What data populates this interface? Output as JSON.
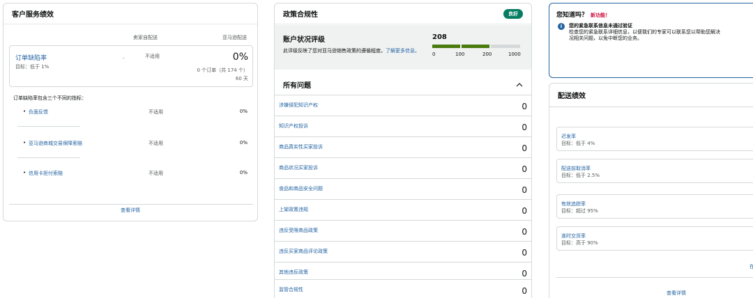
{
  "col1": {
    "title": "客户服务绩效",
    "col_self": "卖家自配送",
    "col_amazon": "亚马逊配送",
    "odr": {
      "name": "订单缺陷率",
      "goal": "目标：低于 1%",
      "dot": ".",
      "self_value": "不适用",
      "amazon_value": "0%",
      "orders": "0 个订单（共 174 个）",
      "days": "60 天"
    },
    "intro": "订单缺陷率包含三个不同的指标：",
    "items": [
      {
        "label": "负面反馈",
        "self": "不适用",
        "amazon": "0%"
      },
      {
        "label": "亚马逊商城交易保障索赔",
        "self": "不适用",
        "amazon": "0%"
      },
      {
        "label": "信用卡拒付索赔",
        "self": "不适用",
        "amazon": "0%"
      }
    ],
    "footer_link": "查看详情"
  },
  "col2": {
    "title": "政策合规性",
    "badge": "良好",
    "badge_color": "#067d62",
    "status_title": "账户状况评级",
    "status_desc_a": "此评级反映了您对亚马逊销售政策的遵循程度。",
    "status_desc_link": "了解更多信息。",
    "score": "208",
    "score_value": 208,
    "ticks": [
      "0",
      "100",
      "200",
      "1000"
    ],
    "issues_title": "所有问题",
    "issues": [
      {
        "label": "涉嫌侵犯知识产权",
        "count": "0"
      },
      {
        "label": "知识产权投诉",
        "count": "0"
      },
      {
        "label": "商品真实性买家投诉",
        "count": "0"
      },
      {
        "label": "商品状况买家投诉",
        "count": "0"
      },
      {
        "label": "食品和商品安全问题",
        "count": "0"
      },
      {
        "label": "上架政策违规",
        "count": "0"
      },
      {
        "label": "违反受限商品政策",
        "count": "0"
      },
      {
        "label": "违反买家商品评论政策",
        "count": "0"
      },
      {
        "label": "其他违反政策",
        "count": "0"
      },
      {
        "label": "监管合规性",
        "count": "0"
      }
    ]
  },
  "col3": {
    "dyk_title": "您知道吗？",
    "new_tag": "新功能！",
    "info_icon": "i",
    "info_title": "您的紧急联系信息未通过验证",
    "info_line1": "检查您的紧急联系详细信息，以便我们的专家可以联系您以帮助您解决",
    "info_line2": "况相关问题，以免中断您的业务。",
    "delivery_title": "配送绩效",
    "rows": [
      {
        "name": "迟发率",
        "goal": "目标：低于 4%"
      },
      {
        "name": "配送前取消率",
        "goal": "目标：低于 2.5%"
      },
      {
        "name": "有效追踪率",
        "goal": "目标：超过 95%"
      },
      {
        "name": "准时交货率",
        "goal": "目标：高于 90%"
      }
    ],
    "cut_link": "在",
    "footer_link": "查看详情"
  }
}
